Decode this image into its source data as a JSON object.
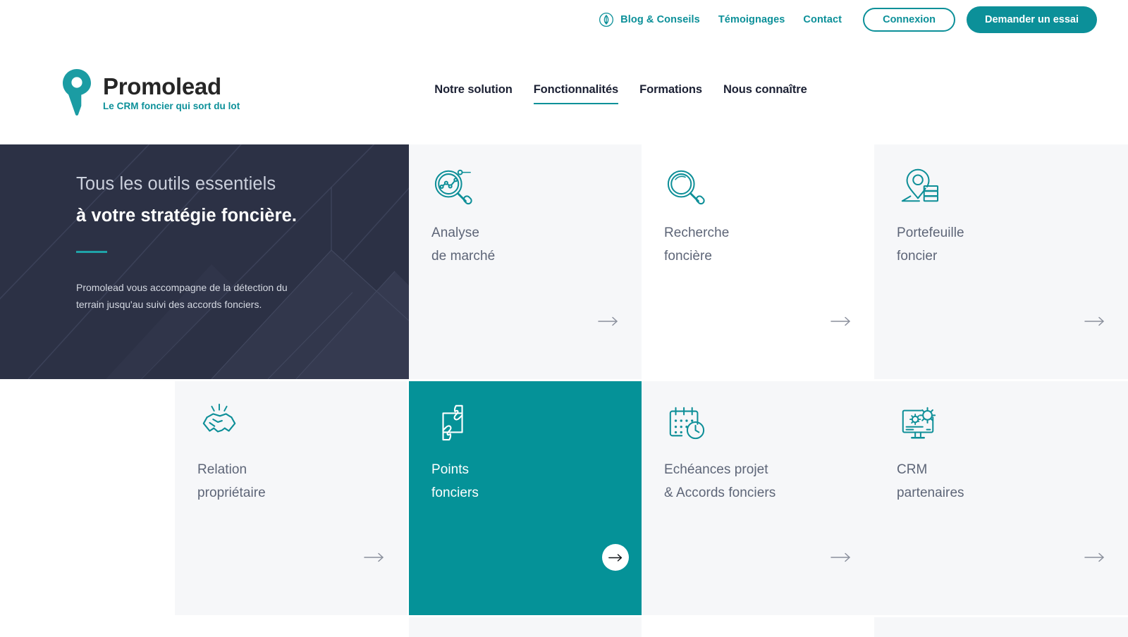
{
  "brand": {
    "accent": "#0C9099",
    "accent_dark": "#059298",
    "dark": "#2C3145",
    "card_bg": "#F6F7F9"
  },
  "topbar": {
    "blog_icon": "feather-quill-icon",
    "blog_label": "Blog & Conseils",
    "testimonials_label": "Témoignages",
    "contact_label": "Contact",
    "login_label": "Connexion",
    "trial_label": "Demander un essai"
  },
  "logo": {
    "icon": "map-pin-icon",
    "name": "Promolead",
    "tagline": "Le CRM foncier qui sort du lot"
  },
  "mainnav": {
    "items": [
      {
        "label": "Notre solution",
        "active": false
      },
      {
        "label": "Fonctionnalités",
        "active": true
      },
      {
        "label": "Formations",
        "active": false
      },
      {
        "label": "Nous connaître",
        "active": false
      }
    ]
  },
  "hero": {
    "line1": "Tous les outils essentiels",
    "line2": "à votre stratégie foncière.",
    "paragraph": "Promolead vous accompagne de la détection du terrain jusqu'au suivi des accords fonciers."
  },
  "cards": {
    "arrow_glyph": "→",
    "row1": [
      {
        "icon": "chart-magnifier-icon",
        "title_line1": "Analyse",
        "title_line2": "de marché",
        "active": false,
        "bg": "#F6F7F9"
      },
      {
        "icon": "search-magnifier-icon",
        "title_line1": "Recherche",
        "title_line2": "foncière",
        "active": false,
        "bg": "#FFFFFF"
      },
      {
        "icon": "pin-database-icon",
        "title_line1": "Portefeuille",
        "title_line2": "foncier",
        "active": false,
        "bg": "#F6F7F9"
      }
    ],
    "row2": [
      {
        "icon": "handshake-icon",
        "title_line1": "Relation",
        "title_line2": "propriétaire",
        "active": false,
        "bg": "#F6F7F9"
      },
      {
        "icon": "hands-parcel-icon",
        "title_line1": "Points",
        "title_line2": "fonciers",
        "active": true,
        "bg": "#059298"
      },
      {
        "icon": "calendar-clock-icon",
        "title_line1": "Echéances projet",
        "title_line2": "& Accords fonciers",
        "active": false,
        "bg": "#F6F7F9"
      },
      {
        "icon": "monitor-gears-icon",
        "title_line1": "CRM",
        "title_line2": "partenaires",
        "active": false,
        "bg": "#F6F7F9"
      }
    ]
  }
}
